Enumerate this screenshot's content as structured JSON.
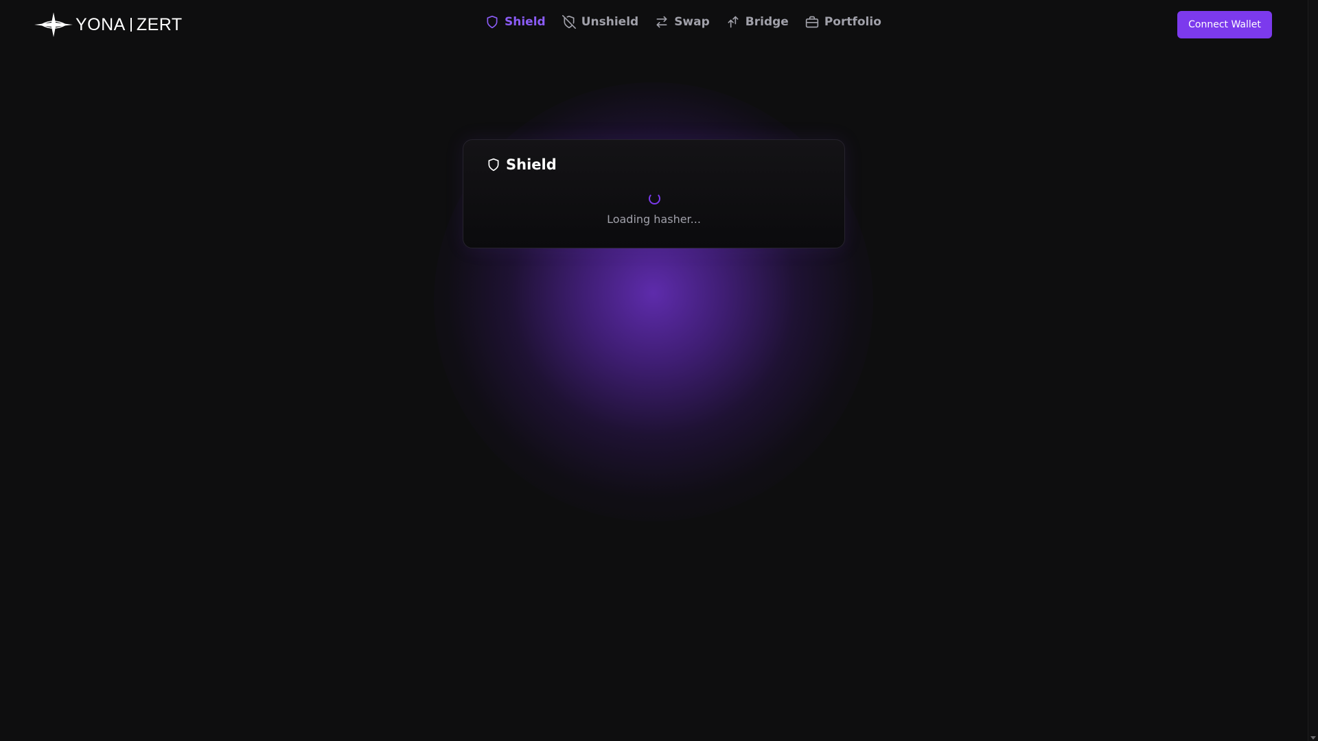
{
  "brand": {
    "name_left": "YONA",
    "name_right": "ZERT"
  },
  "nav": {
    "items": [
      {
        "label": "Shield",
        "icon": "shield-icon",
        "active": true
      },
      {
        "label": "Unshield",
        "icon": "shield-off-icon",
        "active": false
      },
      {
        "label": "Swap",
        "icon": "swap-arrows-icon",
        "active": false
      },
      {
        "label": "Bridge",
        "icon": "bridge-arrows-icon",
        "active": false
      },
      {
        "label": "Portfolio",
        "icon": "briefcase-icon",
        "active": false
      }
    ]
  },
  "header": {
    "connect_label": "Connect Wallet"
  },
  "card": {
    "title": "Shield",
    "title_icon": "shield-icon",
    "loading_text": "Loading hasher..."
  },
  "colors": {
    "accent": "#7c3aed",
    "active_nav": "#8b5cf6",
    "background": "#0e0e0f",
    "muted_text": "#a1a1aa"
  }
}
